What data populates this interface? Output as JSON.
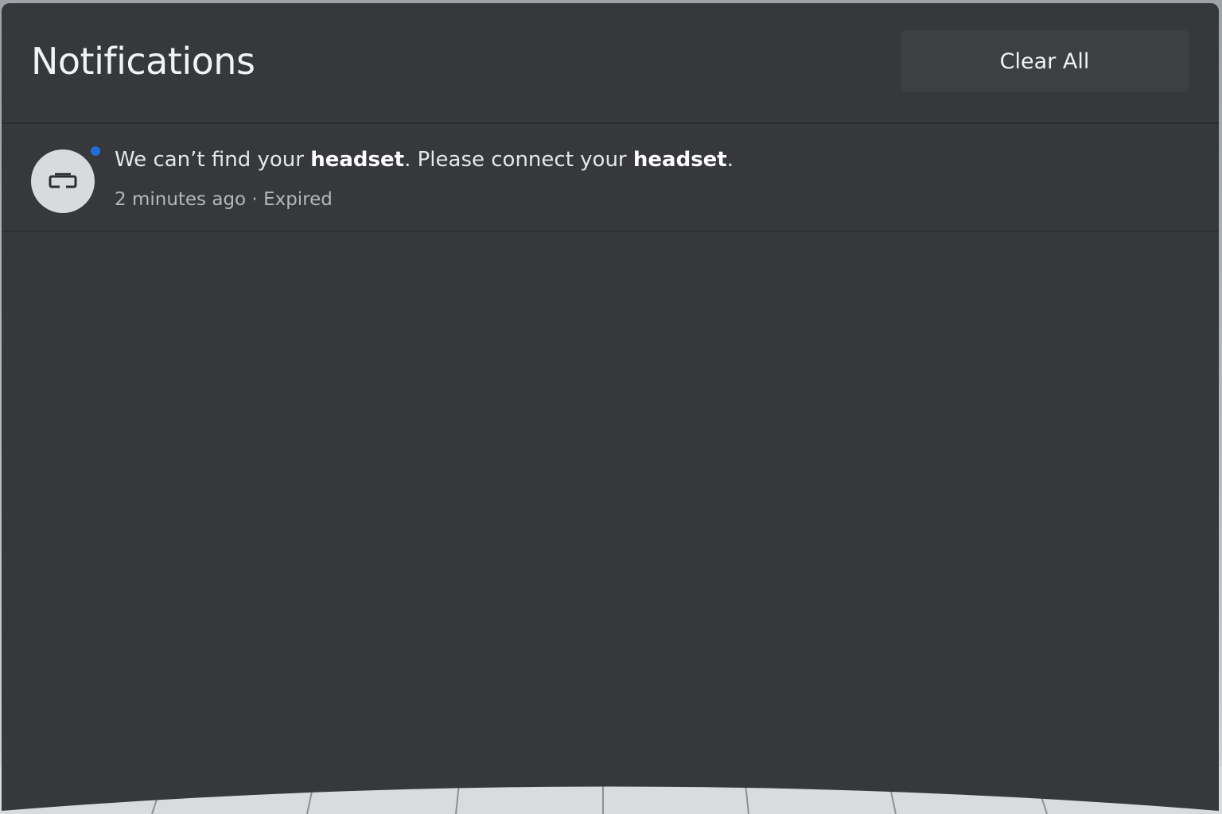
{
  "header": {
    "title": "Notifications",
    "clear_all_label": "Clear All"
  },
  "notifications": [
    {
      "icon": "headset-icon",
      "unread": true,
      "text_parts": {
        "part1": "We can’t find your ",
        "bold1": "headset",
        "part2": ". Please connect your ",
        "bold2": "headset",
        "part3": "."
      },
      "time": "2 minutes ago",
      "separator": " · ",
      "status": "Expired"
    }
  ],
  "colors": {
    "panel_background": "#36383b",
    "unread_dot": "#1f6fd6",
    "text_primary": "#f2f3f4",
    "text_secondary": "#b4b7bb"
  }
}
